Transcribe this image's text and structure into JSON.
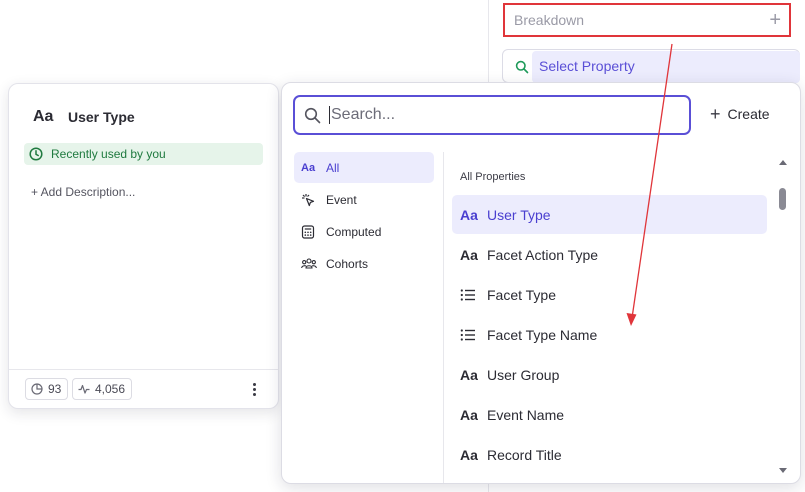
{
  "breakdown": {
    "label": "Breakdown",
    "add_symbol": "+"
  },
  "select_property": {
    "label": "Select Property",
    "icon": "search-icon"
  },
  "info_card": {
    "type_icon": "Aa",
    "title": "User Type",
    "recent_label": "Recently used by you",
    "add_description": "+ Add Description...",
    "stats": [
      {
        "icon": "pie-chart-icon",
        "value": "93"
      },
      {
        "icon": "activity-icon",
        "value": "4,056"
      }
    ]
  },
  "search": {
    "placeholder": "Search...",
    "value": ""
  },
  "create_label": "Create",
  "categories": [
    {
      "icon": "Aa",
      "label": "All",
      "active": true
    },
    {
      "icon": "event-icon",
      "label": "Event",
      "active": false
    },
    {
      "icon": "calculator-icon",
      "label": "Computed",
      "active": false
    },
    {
      "icon": "people-icon",
      "label": "Cohorts",
      "active": false
    }
  ],
  "properties_header": "All Properties",
  "properties": [
    {
      "icon": "Aa",
      "label": "User Type",
      "active": true
    },
    {
      "icon": "Aa",
      "label": "Facet Action Type",
      "active": false
    },
    {
      "icon": "list-icon",
      "label": "Facet Type",
      "active": false
    },
    {
      "icon": "list-icon",
      "label": "Facet Type Name",
      "active": false
    },
    {
      "icon": "Aa",
      "label": "User Group",
      "active": false
    },
    {
      "icon": "Aa",
      "label": "Event Name",
      "active": false
    },
    {
      "icon": "Aa",
      "label": "Record Title",
      "active": false
    }
  ],
  "colors": {
    "accent": "#5a4fd6",
    "highlight": "#ececfd",
    "annotation": "#e0353a",
    "success": "#1f7a3f"
  }
}
